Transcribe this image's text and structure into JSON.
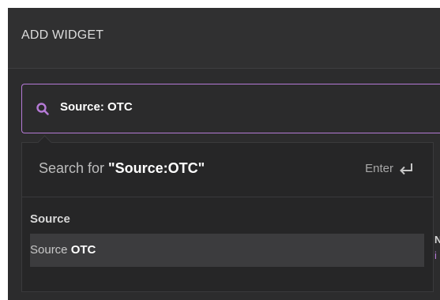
{
  "header": {
    "title": "ADD WIDGET"
  },
  "search": {
    "value": "Source: OTC",
    "icon": "search-icon",
    "accent_color": "#b57ad6"
  },
  "dropdown": {
    "search_for_prefix": "Search for ",
    "search_for_query": "\"Source:OTC\"",
    "enter_label": "Enter",
    "enter_icon": "enter-return-icon",
    "group_label": "Source",
    "results": [
      {
        "prefix": "Source ",
        "match": "OTC"
      }
    ]
  },
  "edge_fragments": {
    "line1": "N",
    "line2": "i"
  }
}
